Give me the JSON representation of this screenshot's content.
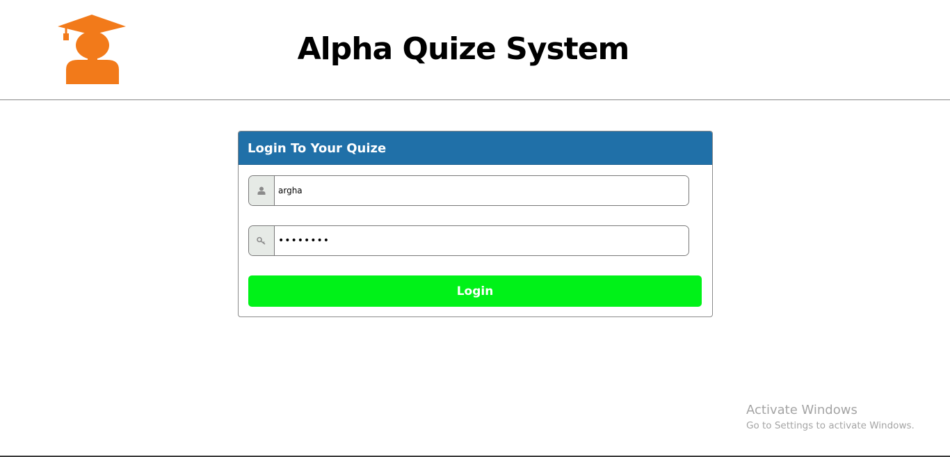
{
  "header": {
    "title": "Alpha Quize System",
    "logo_icon": "graduate-avatar-icon",
    "logo_color": "#f27a1a"
  },
  "login_panel": {
    "heading": "Login To Your Quize",
    "heading_color": "#2070a8",
    "username": {
      "icon": "user-icon",
      "value": "argha"
    },
    "password": {
      "icon": "key-icon",
      "value": "argha123"
    },
    "login_button": {
      "label": "Login",
      "color": "#00f218"
    }
  },
  "watermark": {
    "title": "Activate Windows",
    "subtitle": "Go to Settings to activate Windows."
  }
}
